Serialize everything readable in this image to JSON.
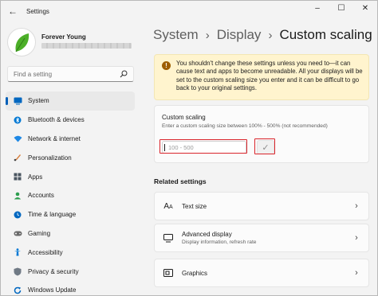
{
  "window": {
    "app_title": "Settings",
    "controls": {
      "minimize": "–",
      "maximize": "☐",
      "close": "✕"
    }
  },
  "profile": {
    "name": "Forever Young"
  },
  "search": {
    "placeholder": "Find a setting"
  },
  "sidebar": {
    "selected_index": 0,
    "items": [
      {
        "label": "System",
        "icon": "system-icon",
        "color": "#0067c0"
      },
      {
        "label": "Bluetooth & devices",
        "icon": "bluetooth-icon",
        "color": "#0078d4"
      },
      {
        "label": "Network & internet",
        "icon": "network-icon",
        "color": "#1e88e5"
      },
      {
        "label": "Personalization",
        "icon": "personalization-icon",
        "color": "#d77d3a"
      },
      {
        "label": "Apps",
        "icon": "apps-icon",
        "color": "#4a5560"
      },
      {
        "label": "Accounts",
        "icon": "accounts-icon",
        "color": "#2e9e4f"
      },
      {
        "label": "Time & language",
        "icon": "time-language-icon",
        "color": "#0067c0"
      },
      {
        "label": "Gaming",
        "icon": "gaming-icon",
        "color": "#6b6b6b"
      },
      {
        "label": "Accessibility",
        "icon": "accessibility-icon",
        "color": "#0078d4"
      },
      {
        "label": "Privacy & security",
        "icon": "shield-icon",
        "color": "#707a85"
      },
      {
        "label": "Windows Update",
        "icon": "windows-update-icon",
        "color": "#0067c0"
      }
    ]
  },
  "breadcrumb": {
    "parts": [
      "System",
      "Display"
    ],
    "separator": "›",
    "current": "Custom scaling"
  },
  "warning": {
    "icon": "!",
    "text": "You shouldn't change these settings unless you need to—it can cause text and apps to become unreadable. All your displays will be set to the custom scaling size you enter and it can be difficult to go back to your original settings."
  },
  "custom_scaling": {
    "title": "Custom scaling",
    "description": "Enter a custom scaling size between 100% - 500% (not recommended)",
    "input_placeholder": "100 - 500",
    "input_value": "",
    "apply_glyph": "✓"
  },
  "related": {
    "title": "Related settings",
    "items": [
      {
        "title": "Text size",
        "subtitle": "",
        "icon": "text-size-icon",
        "glyph": "Aᴬ"
      },
      {
        "title": "Advanced display",
        "subtitle": "Display information, refresh rate",
        "icon": "monitor-icon",
        "glyph": "▭"
      },
      {
        "title": "Graphics",
        "subtitle": "",
        "icon": "graphics-icon",
        "glyph": "▣"
      }
    ],
    "chevron": "›"
  },
  "colors": {
    "accent": "#005fb8",
    "warning_bg": "#fff4ce",
    "warning_icon": "#9d5d00",
    "highlight": "#d9242b",
    "avatar_leaf": "#4caf28"
  }
}
